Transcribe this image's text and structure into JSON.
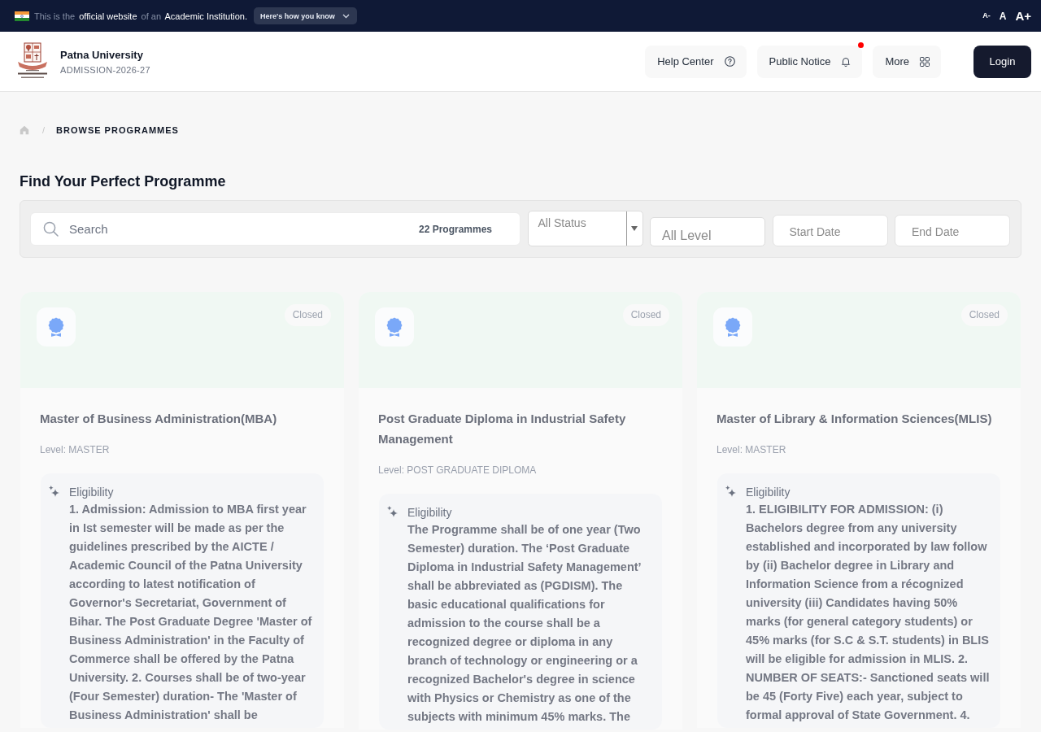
{
  "top_bar": {
    "notice": [
      {
        "text": "This is the",
        "emphasis": false
      },
      {
        "text": "official website",
        "emphasis": true
      },
      {
        "text": "of an",
        "emphasis": false
      },
      {
        "text": "Academic Institution.",
        "emphasis": true
      }
    ],
    "how_you_know": "Here's how you know",
    "text_size": [
      {
        "label": "A-",
        "kind": "smaller"
      },
      {
        "label": "A",
        "kind": "normal"
      },
      {
        "label": "A+",
        "kind": "larger"
      }
    ]
  },
  "header": {
    "name": "Patna University",
    "session": "ADMISSION-2026-27",
    "nav": [
      {
        "label": "Help Center",
        "kind": "help",
        "alert": false
      },
      {
        "label": "Public Notice",
        "kind": "notice",
        "alert": true
      },
      {
        "label": "More",
        "kind": "more",
        "alert": false
      }
    ],
    "login": "Login"
  },
  "breadcrumb": {
    "separator": "/",
    "current": "BROWSE PROGRAMMES"
  },
  "title": "Find Your Perfect Programme",
  "filters": {
    "search": {
      "placeholder": "Search"
    },
    "count": "22 Programmes",
    "status": {
      "value": "All Status"
    },
    "level": {
      "placeholder": "All Level"
    },
    "start_date": {
      "placeholder": "Start Date"
    },
    "end_date": {
      "placeholder": "End Date"
    }
  },
  "programmes": [
    {
      "status": "Closed",
      "title": "Master of Business Administration(MBA)",
      "level": "Level: MASTER",
      "eligibility_label": "Eligibility",
      "eligibility": "1. Admission: Admission to MBA first year in Ist semester will be made as per the guidelines prescribed by the AICTE / Academic Council of the Patna University according to latest notification of Governor's Secretariat, Government of Bihar. The Post Graduate Degree 'Master of Business Administration' in the Faculty of Commerce shall be offered by the Patna University. 2. Courses shall be of two-year (Four Semester) duration- The 'Master of Business Administration' shall be"
    },
    {
      "status": "Closed",
      "title": "Post Graduate Diploma in Industrial Safety Management",
      "level": "Level: POST GRADUATE DIPLOMA",
      "eligibility_label": "Eligibility",
      "eligibility": "The Programme shall be of one year (Two Semester) duration. The ‘Post Graduate Diploma in Industrial Safety Management’ shall be abbreviated as (PGDISM). The basic educational qualifications for admission to the course shall be a recognized degree or diploma in any branch of technology or engineering or a recognized Bachelor's degree in science with Physics or Chemistry as one of the subjects with minimum 45% marks. The"
    },
    {
      "status": "Closed",
      "title": "Master of Library & Information Sciences(MLIS)",
      "level": "Level: MASTER",
      "eligibility_label": "Eligibility",
      "eligibility": "1. ELIGIBILITY FOR ADMISSION: (i) Bachelors degree from any university established and incorporated by law follow by (ii) Bachelor degree in Library and Information Science from a récognized university (iii) Candidates having 50% marks (for general category students) or 45% marks (for S.C & S.T. students) in BLIS will be eligible for admission in MLIS. 2. NUMBER OF SEATS:- Sanctioned seats will be 45 (Forty Five) each year, subject to formal approval of State Government. 4."
    }
  ]
}
